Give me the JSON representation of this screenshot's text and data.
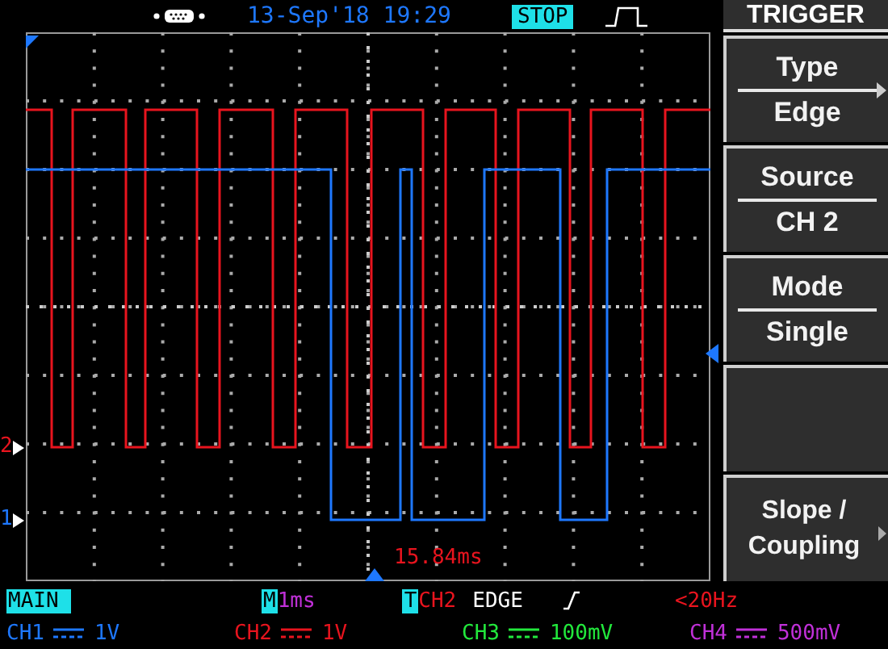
{
  "status_bar": {
    "date_time": "13-Sep'18 19:29",
    "run_state": "STOP"
  },
  "menu": {
    "title": "TRIGGER",
    "items": [
      {
        "kind": "cycle",
        "label": "Type",
        "value": "Edge"
      },
      {
        "kind": "option",
        "label": "Source",
        "value": "CH 2"
      },
      {
        "kind": "option",
        "label": "Mode",
        "value": "Single"
      },
      {
        "kind": "empty"
      },
      {
        "kind": "submenu",
        "label": "Slope / Coupling"
      }
    ]
  },
  "graticule": {
    "markers": [
      {
        "label": "2",
        "color": "#e8141e"
      },
      {
        "label": "1",
        "color": "#1e78ff"
      }
    ],
    "cursor_reading": "15.84ms"
  },
  "timebase": {
    "mode": "MAIN",
    "prefix": "M",
    "value": "1ms"
  },
  "trigger": {
    "prefix": "T",
    "source": "CH2",
    "type": "EDGE",
    "frequency": "<20Hz"
  },
  "channels": [
    {
      "name": "CH1",
      "scale": "1V",
      "color": "#1e78ff"
    },
    {
      "name": "CH2",
      "scale": "1V",
      "color": "#e8141e"
    },
    {
      "name": "CH3",
      "scale": "100mV",
      "color": "#22e83c"
    },
    {
      "name": "CH4",
      "scale": "500mV",
      "color": "#c030d8"
    }
  ]
}
